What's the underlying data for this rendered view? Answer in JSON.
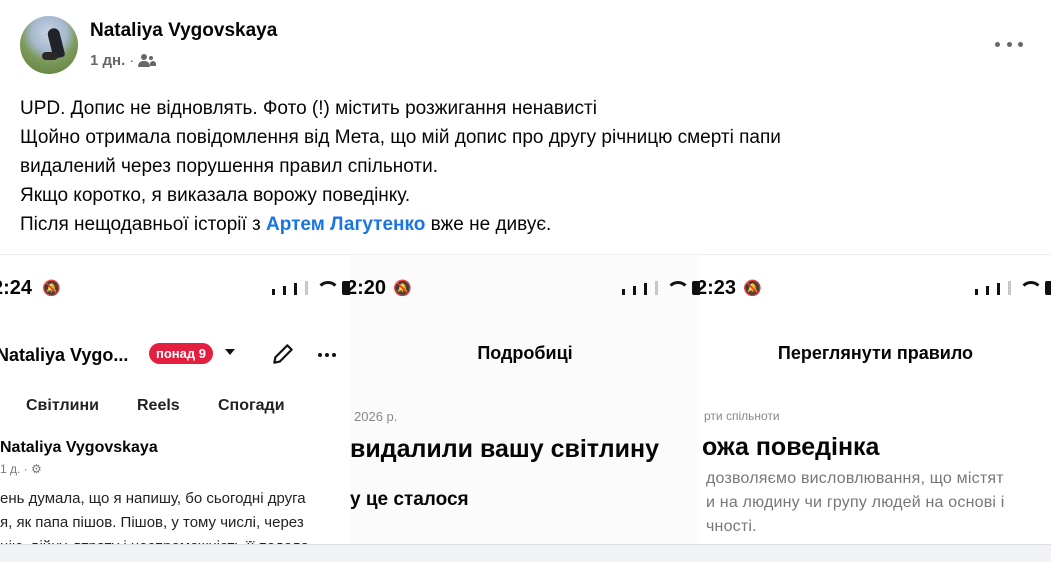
{
  "post": {
    "author": "Nataliya Vygovskaya",
    "time": "1 дн.",
    "separator": "·",
    "privacy_icon": "friends-icon",
    "more_icon": "more-horizontal-icon",
    "lines": [
      "UPD.  Допис не відновлять. Фото (!) містить розжигання ненависті",
      "Щойно отримала повідомлення від Мета, що мій допис про другу річницю смерті папи",
      "видалений через порушення правил спільноти.",
      "Якщо коротко, я виказала ворожу поведінку."
    ],
    "last_line_before": "Після нещодавньої історії з ",
    "mention": "Артем Лагутенко",
    "last_line_after": " вже не дивує."
  },
  "screenshots": {
    "shot1": {
      "time": "2:24",
      "header_name": "Nataliya Vygo...",
      "badge": "понад 9",
      "tabs": [
        "Світлини",
        "Reels",
        "Спогади"
      ],
      "author": "Nataliya Vygovskaya",
      "meta": "1 д. ·",
      "text_lines": [
        "ень думала, що я напишу, бо сьогодні друга",
        "я, як папа пішов. Пішов, у тому числі, через",
        "цію, війну, втрату і неспроможність її подола"
      ]
    },
    "shot2": {
      "time": "2:20",
      "title": "Подробиці",
      "date": "2026 р.",
      "heading": "видалили вашу світлину",
      "subheading": "у це сталося"
    },
    "shot3": {
      "time": "2:23",
      "title": "Переглянути правило",
      "small": "рти спільноти",
      "heading": "ожа поведінка",
      "text_lines": [
        " дозволяємо висловлювання, що містят",
        "и на людину чи групу людей на основі і",
        "чності."
      ]
    }
  },
  "colors": {
    "link": "#1b74e4",
    "badge": "#e41e3f",
    "secondary_text": "#65676b"
  }
}
